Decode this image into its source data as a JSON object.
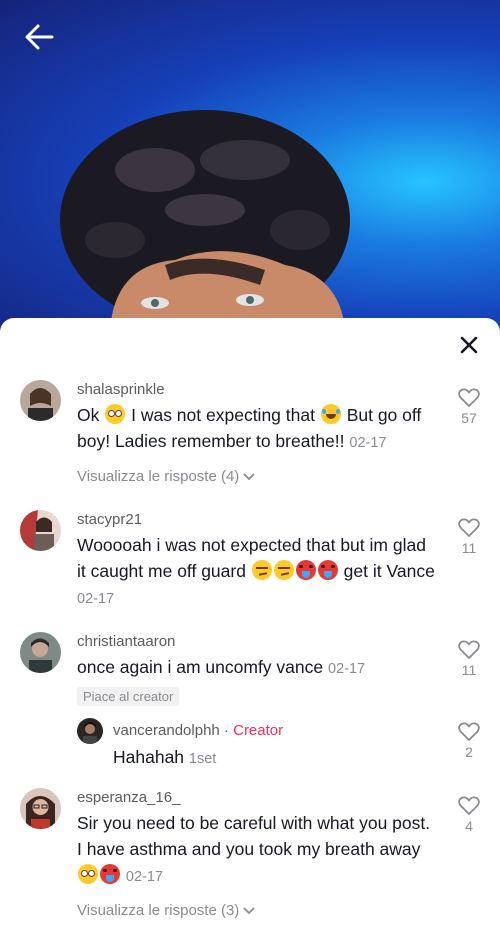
{
  "sheet": {
    "comments": [
      {
        "username": "shalasprinkle",
        "text_before": "Ok ",
        "text_mid": " I was not expecting that ",
        "text_after": " But go off boy! Ladies remember to breathe!!",
        "date": "02-17",
        "likes": "57",
        "view_replies": "Visualizza le risposte (4)"
      },
      {
        "username": "stacypr21",
        "text_before": "Wooooah i was not expected that but im glad it caught me off guard ",
        "text_after": " get it Vance",
        "date": "02-17",
        "likes": "11"
      },
      {
        "username": "christiantaaron",
        "text": "once again i am uncomfy vance",
        "date": "02-17",
        "likes": "11",
        "liked_by_creator": "Piace al creator",
        "reply": {
          "username": "vancerandolphh",
          "separator": " · ",
          "badge": "Creator",
          "text": "Hahahah",
          "date": "1set",
          "likes": "2"
        }
      },
      {
        "username": "esperanza_16_",
        "text_before": "Sir you need to be careful with what you post. I have asthma and you took my breath away ",
        "date": "02-17",
        "likes": "4",
        "view_replies": "Visualizza le risposte (3)"
      }
    ]
  },
  "icons": {
    "back": "arrow-left-icon",
    "close": "close-icon",
    "like": "heart-outline-icon",
    "chevron": "chevron-down-icon"
  },
  "colors": {
    "creator_badge": "#fe2c55",
    "secondary_text": "#8a8b91",
    "primary_text": "#161823"
  }
}
